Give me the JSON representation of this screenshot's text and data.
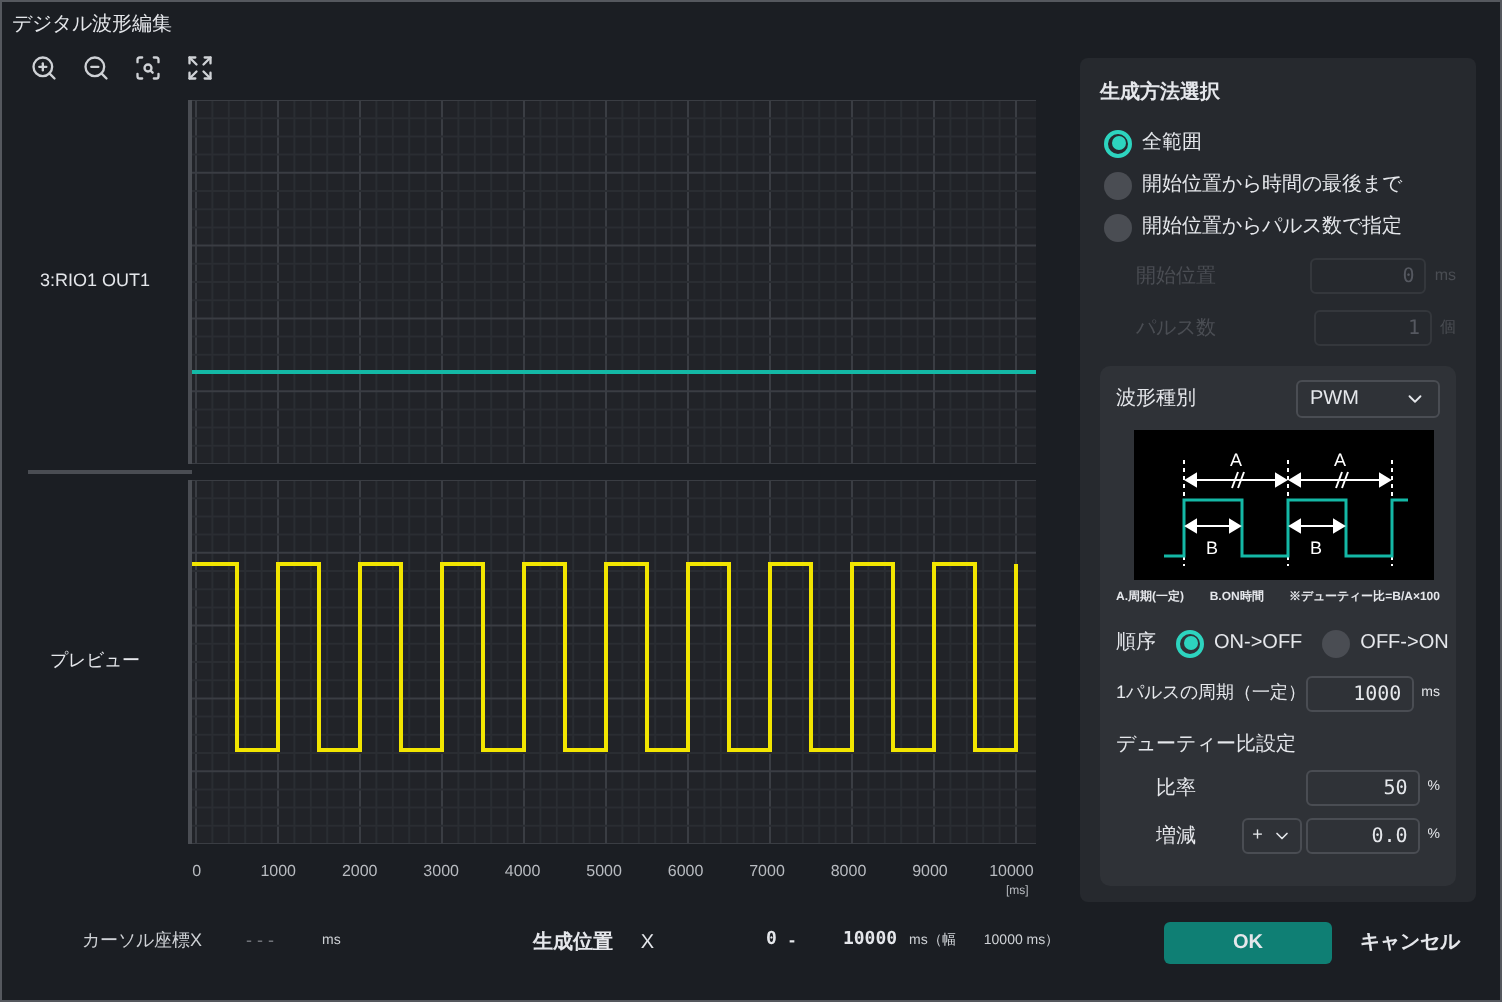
{
  "window": {
    "title": "デジタル波形編集"
  },
  "toolbar": [
    {
      "kind": "zoom_in"
    },
    {
      "kind": "zoom_out"
    },
    {
      "kind": "zoom_fit"
    },
    {
      "kind": "expand"
    }
  ],
  "channels": [
    {
      "label": "3:RIO1 OUT1",
      "kind": "flat",
      "color": "#14b8a6"
    },
    {
      "label": "プレビュー",
      "kind": "pwm",
      "color": "#f2e500"
    }
  ],
  "x_axis": {
    "ticks": [
      "0",
      "1000",
      "2000",
      "3000",
      "4000",
      "5000",
      "6000",
      "7000",
      "8000",
      "9000",
      "10000"
    ],
    "unit": "[ms]"
  },
  "generation": {
    "title": "生成方法選択",
    "options": [
      {
        "label": "全範囲",
        "selected": true
      },
      {
        "label": "開始位置から時間の最後まで",
        "selected": false
      },
      {
        "label": "開始位置からパルス数で指定",
        "selected": false
      }
    ],
    "fields": [
      {
        "label": "開始位置",
        "value": "0",
        "unit": "ms",
        "disabled": true
      },
      {
        "label": "パルス数",
        "value": "1",
        "unit": "個",
        "disabled": true
      }
    ]
  },
  "waveform": {
    "type_label": "波形種別",
    "type_value": "PWM",
    "diagram_labels": [
      "A",
      "A",
      "B",
      "B"
    ],
    "caption": [
      "A.周期(一定)",
      "B.ON時間",
      "※デューティー比=B/A×100"
    ],
    "order_label": "順序",
    "order_options": [
      {
        "label": "ON->OFF",
        "selected": true
      },
      {
        "label": "OFF->ON",
        "selected": false
      }
    ],
    "period_label": "1パルスの周期（一定）",
    "period_value": "1000",
    "period_unit": "ms",
    "duty_title": "デューティー比設定",
    "ratio_label": "比率",
    "ratio_value": "50",
    "ratio_unit": "%",
    "delta_label": "増減",
    "delta_sign": "+",
    "delta_value": "0.0",
    "delta_unit": "%"
  },
  "status": {
    "cursor_label": "カーソル座標X",
    "cursor_value": "- - -",
    "cursor_unit": "ms",
    "range_label": "生成位置",
    "range_axis": "X",
    "range_start": "0",
    "range_sep": "-",
    "range_end": "10000",
    "width_prefix": "ms（幅",
    "width_value": "10000 ms）"
  },
  "buttons": {
    "ok": "OK",
    "cancel": "キャンセル"
  }
}
